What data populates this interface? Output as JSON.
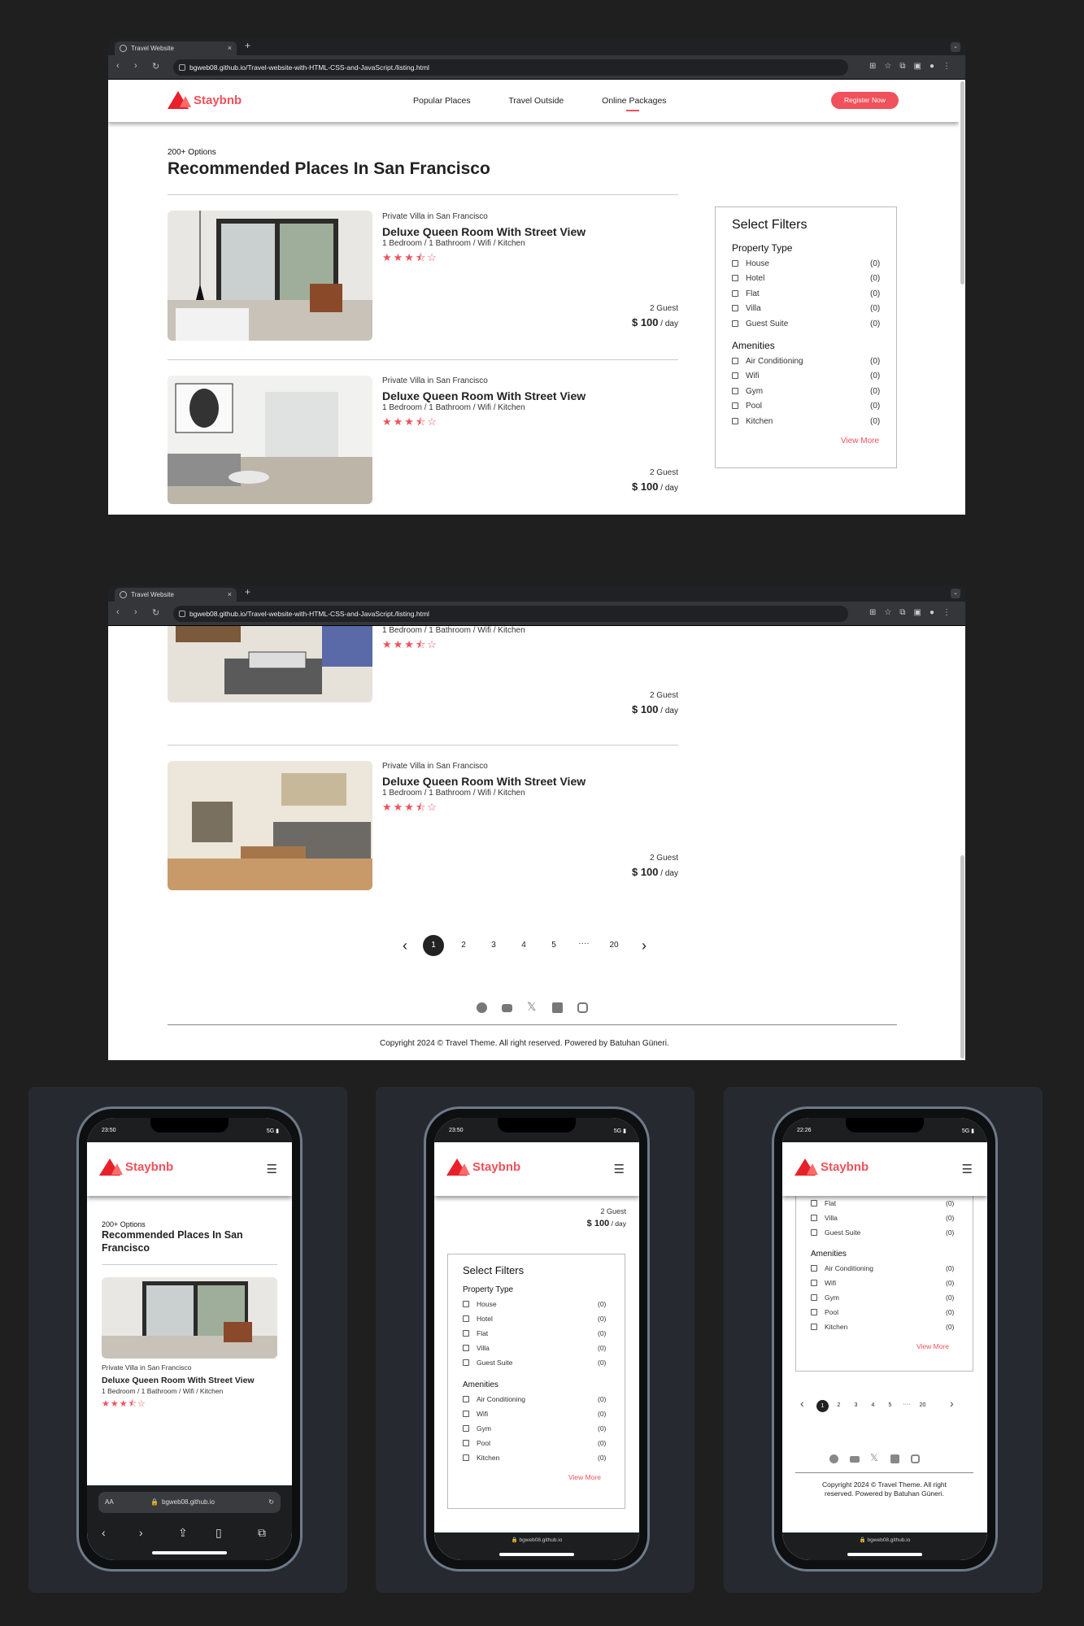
{
  "browser": {
    "tab_title": "Travel Website",
    "tab_close": "×",
    "new_tab": "+",
    "url": "bgweb08.github.io/Travel-website-with-HTML-CSS-and-JavaScript./listing.html",
    "nav_back": "‹",
    "nav_forward": "›",
    "nav_reload": "↻"
  },
  "site": {
    "brand": "Staybnb",
    "nav": [
      "Popular Places",
      "Travel Outside",
      "Online Packages"
    ],
    "register": "Register Now",
    "options": "200+ Options",
    "heading": "Recommended Places In San Francisco",
    "heading_mobile_1": "Recommended Places In San",
    "heading_mobile_2": "Francisco"
  },
  "listing": {
    "location": "Private Villa in San Francisco",
    "title": "Deluxe Queen Room With Street View",
    "features": "1 Bedroom / 1 Bathroom / Wifi / Kitchen",
    "stars": "★★★⯪☆",
    "rating": 3.5,
    "guests": "2 Guest",
    "price": "$ 100",
    "per": " / day"
  },
  "filters": {
    "title": "Select Filters",
    "property_title": "Property Type",
    "property": [
      {
        "label": "House",
        "count": "(0)"
      },
      {
        "label": "Hotel",
        "count": "(0)"
      },
      {
        "label": "Flat",
        "count": "(0)"
      },
      {
        "label": "Villa",
        "count": "(0)"
      },
      {
        "label": "Guest Suite",
        "count": "(0)"
      }
    ],
    "amenities_title": "Amenities",
    "amenities": [
      {
        "label": "Air Conditioning",
        "count": "(0)"
      },
      {
        "label": "Wifi",
        "count": "(0)"
      },
      {
        "label": "Gym",
        "count": "(0)"
      },
      {
        "label": "Pool",
        "count": "(0)"
      },
      {
        "label": "Kitchen",
        "count": "(0)"
      }
    ],
    "view_more": "View More"
  },
  "pagination": {
    "prev": "‹",
    "next": "›",
    "pages": [
      "1",
      "2",
      "3",
      "4",
      "5",
      "····",
      "20"
    ],
    "current": "1"
  },
  "footer": {
    "copyright": "Copyright 2024 © Travel Theme. All right reserved. Powered by Batuhan Güneri.",
    "copyright_mobile_1": "Copyright 2024 © Travel Theme. All right",
    "copyright_mobile_2": "reserved. Powered by Batuhan Güneri.",
    "social": [
      "facebook-icon",
      "youtube-icon",
      "x-icon",
      "linkedin-icon",
      "instagram-icon"
    ]
  },
  "phones": [
    {
      "time": "23:50",
      "signal": "5G"
    },
    {
      "time": "23:50",
      "signal": "5G"
    },
    {
      "time": "22:26",
      "signal": "5G"
    }
  ],
  "safari": {
    "aa": "AA",
    "domain": "bgweb08.github.io",
    "bottom_domain": "🔒 bgweb08.github.io"
  },
  "colors": {
    "accent": "#f0515b",
    "logo": "#e8202a",
    "bg": "#1f1f1f",
    "card": "#262a30"
  }
}
